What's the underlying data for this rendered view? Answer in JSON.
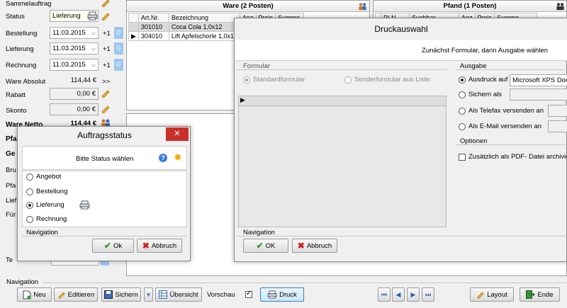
{
  "left_panel": {
    "sammelauftrag_label": "Sammelauftrag",
    "status_label": "Status",
    "status_value": "Lieferung",
    "bestellung_label": "Bestellung",
    "bestellung_date": "11.03.2015",
    "lieferung_label": "Lieferung",
    "lieferung_date": "11.03.2015",
    "rechnung_label": "Rechnung",
    "rechnung_date": "11.03.2015",
    "plus_one": "+1",
    "zero": "0",
    "ware_absolut_label": "Ware Absolut",
    "ware_absolut_value": "114,44 €",
    "ware_absolut_arrow": ">>",
    "rabatt_label": "Rabatt",
    "rabatt_value": "0,00 €",
    "skonto_label": "Skonto",
    "skonto_value": "0,00 €",
    "ware_netto_label": "Ware Netto",
    "ware_netto_value": "114,44 €",
    "pf_label": "Pfa",
    "ge_label": "Ge",
    "bru_label": "Bru",
    "pfa2_label": "Pfa",
    "lief_label": "Lief",
    "fur_label": "Für",
    "ter_label": "Te"
  },
  "ware_panel": {
    "title": "Ware (2 Posten)",
    "columns": [
      "Art.Nr.",
      "Bezeichnung",
      "Anz",
      "Preis",
      "Summe"
    ],
    "rows": [
      {
        "artnr": "301010",
        "bez": "Coca Cola 1,0x12"
      },
      {
        "artnr": "304010",
        "bez": "Lift Apfelschorle 1,0x12"
      }
    ]
  },
  "pfand_panel": {
    "title": "Pfand (1 Posten)",
    "columns": [
      "PLN",
      "Suchbar",
      "Anz",
      "Preis",
      "Summe"
    ]
  },
  "druck_dialog": {
    "title": "Druckauswahl",
    "instruction": "Zunächst Formular, dann Ausgabe wählen",
    "formular_group": "Formular",
    "standard_label": "Standardformular",
    "sonder_label": "Sonderformular aus Liste:",
    "ausgabe_group": "Ausgabe",
    "ausdruck_label": "Ausdruck auf",
    "printer_value": "Microsoft XPS Doc",
    "sichern_label": "Sichern als",
    "telefax_label": "Als Telefax versenden an",
    "email_label": "Als E-Mail versenden an",
    "optionen_group": "Optionen",
    "pdf_label": "Zusätzlich als PDF- Datei archiviere",
    "navigation_label": "Navigation",
    "ok_label": "OK",
    "abbruch_label": "Abbruch"
  },
  "status_dialog": {
    "title": "Auftragsstatus",
    "instruction": "Bitte Status wählen",
    "options": [
      "Angebot",
      "Bestellung",
      "Lieferung",
      "Rechnung"
    ],
    "navigation_label": "Navigation",
    "ok_label": "Ok",
    "abbruch_label": "Abbruch"
  },
  "bottom_bar": {
    "navigation_label": "Navigation",
    "neu": "Neu",
    "editieren": "Editieren",
    "sichern": "Sichern",
    "uebersicht": "Übersicht",
    "vorschau": "Vorschau",
    "druck": "Druck",
    "layout": "Layout",
    "ende": "Ende"
  }
}
